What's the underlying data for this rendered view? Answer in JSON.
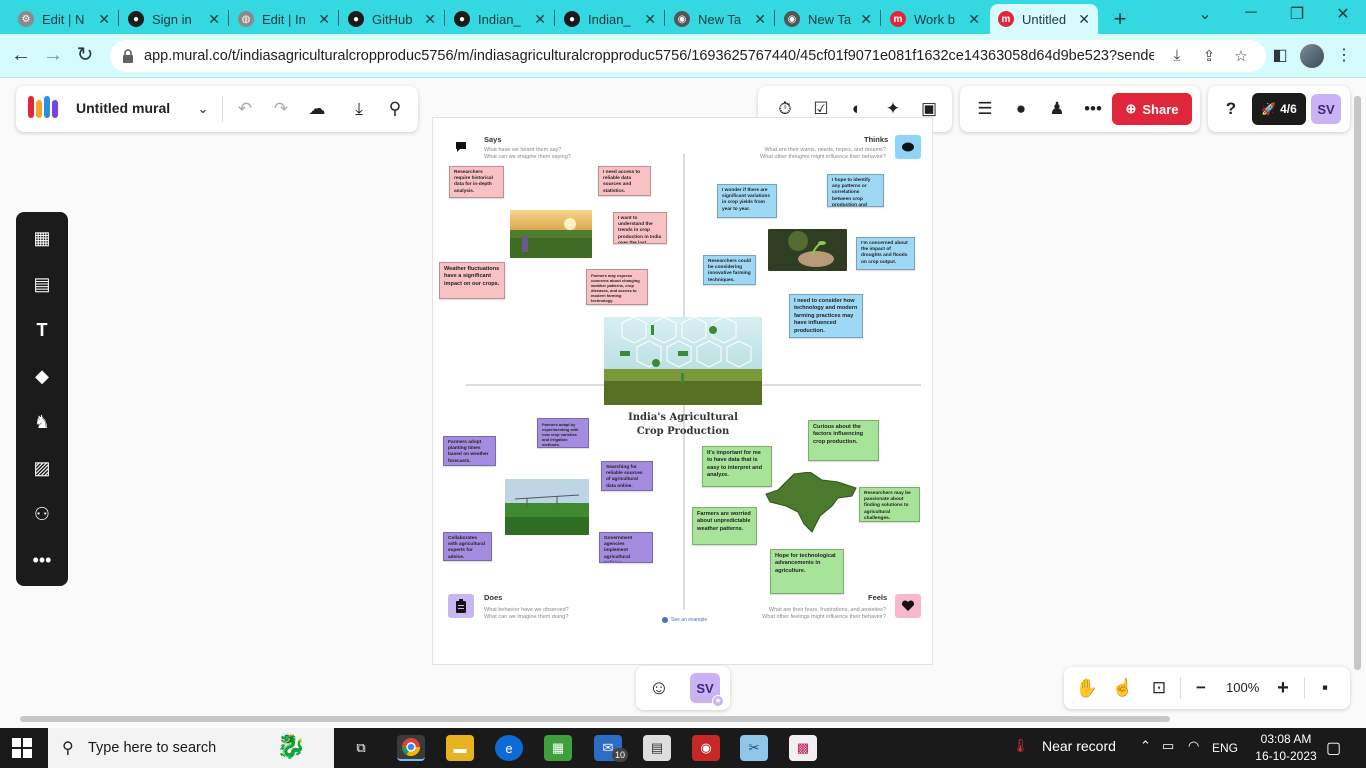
{
  "browser": {
    "tabs": [
      {
        "label": "Edit | N",
        "favicon": "gear-icon",
        "color": "#a0a0a0"
      },
      {
        "label": "Sign in",
        "favicon": "github-icon",
        "color": "#1b1b1b"
      },
      {
        "label": "Edit | In",
        "favicon": "globe-icon",
        "color": "#a0a0a0"
      },
      {
        "label": "GitHub",
        "favicon": "github-icon",
        "color": "#1b1b1b"
      },
      {
        "label": "Indian_",
        "favicon": "github-icon",
        "color": "#1b1b1b"
      },
      {
        "label": "Indian_",
        "favicon": "github-icon",
        "color": "#1b1b1b"
      },
      {
        "label": "New Ta",
        "favicon": "chrome-icon",
        "color": "#555555"
      },
      {
        "label": "New Ta",
        "favicon": "chrome-icon",
        "color": "#555555"
      },
      {
        "label": "Work b",
        "favicon": "mural-icon",
        "color": "#e0263a"
      },
      {
        "label": "Untitled",
        "favicon": "mural-icon",
        "color": "#e0263a",
        "active": true
      }
    ],
    "url": "app.mural.co/t/indiasagriculturalcropproduc5756/m/indiasagriculturalcropproduc5756/1693625767440/45cf01f9071e081f1632ce14363058d64d9be523?sender=u..."
  },
  "mural": {
    "title": "Untitled mural",
    "share_label": "Share",
    "rocket_label": "4/6",
    "user_initials": "SV",
    "zoom_level": "100%",
    "accent_color": "#e0263a"
  },
  "board": {
    "center_title_line1": "India's Agricultural",
    "center_title_line2": "Crop Production",
    "see_example": "See an example",
    "quadrants": {
      "says": {
        "title": "Says",
        "sub1": "What have we heard them say?",
        "sub2": "What can we imagine them saying?"
      },
      "thinks": {
        "title": "Thinks",
        "sub1": "What are their wants, needs, hopes, and dreams?",
        "sub2": "What other thoughts might influence their behavior?"
      },
      "does": {
        "title": "Does",
        "sub1": "What behavior have we observed?",
        "sub2": "What can we imagine them doing?"
      },
      "feels": {
        "title": "Feels",
        "sub1": "What are their fears, frustrations, and anxieties?",
        "sub2": "What other feelings might influence their behavior?"
      }
    },
    "notes": {
      "says": [
        "Researchers require historical data for in-depth analysis.",
        "I need access to reliable data sources and statistics.",
        "I want to understand the trends in crop production in India over the last couple of decades.",
        "Weather fluctuations have a significant impact on our crops.",
        "Farmers may express concerns about changing weather patterns, crop diseases, and access to modern farming technology."
      ],
      "thinks": [
        "I wonder if there are significant variations in crop yields from year to year.",
        "I hope to identify any patterns or correlations between crop production and climate factors.",
        "Researchers could be considering innovative farming techniques.",
        "I'm concerned about the impact of droughts and floods on crop output.",
        "I need to consider how technology and modern farming practices may have influenced production."
      ],
      "does": [
        "Farmers adapt by experimenting with new crop varieties and irrigation methods.",
        "Farmers adopt planting times based on weather forecasts.",
        "Searching for reliable sources of agricultural data online.",
        "Collaborates with agricultural experts for advice.",
        "Government agencies implement agricultural policies."
      ],
      "feels": [
        "Curious about the factors influencing crop production.",
        "It's important for me to have data that is easy to interpret and analyze.",
        "Researchers may be passionate about finding solutions to agricultural challenges.",
        "Farmers are worried about unpredictable weather patterns.",
        "Hope for technological advancements in agriculture."
      ]
    }
  },
  "taskbar": {
    "search_placeholder": "Type here to search",
    "weather": "Near record",
    "language": "ENG",
    "time": "03:08 AM",
    "date": "16-10-2023",
    "mail_badge": "10"
  }
}
